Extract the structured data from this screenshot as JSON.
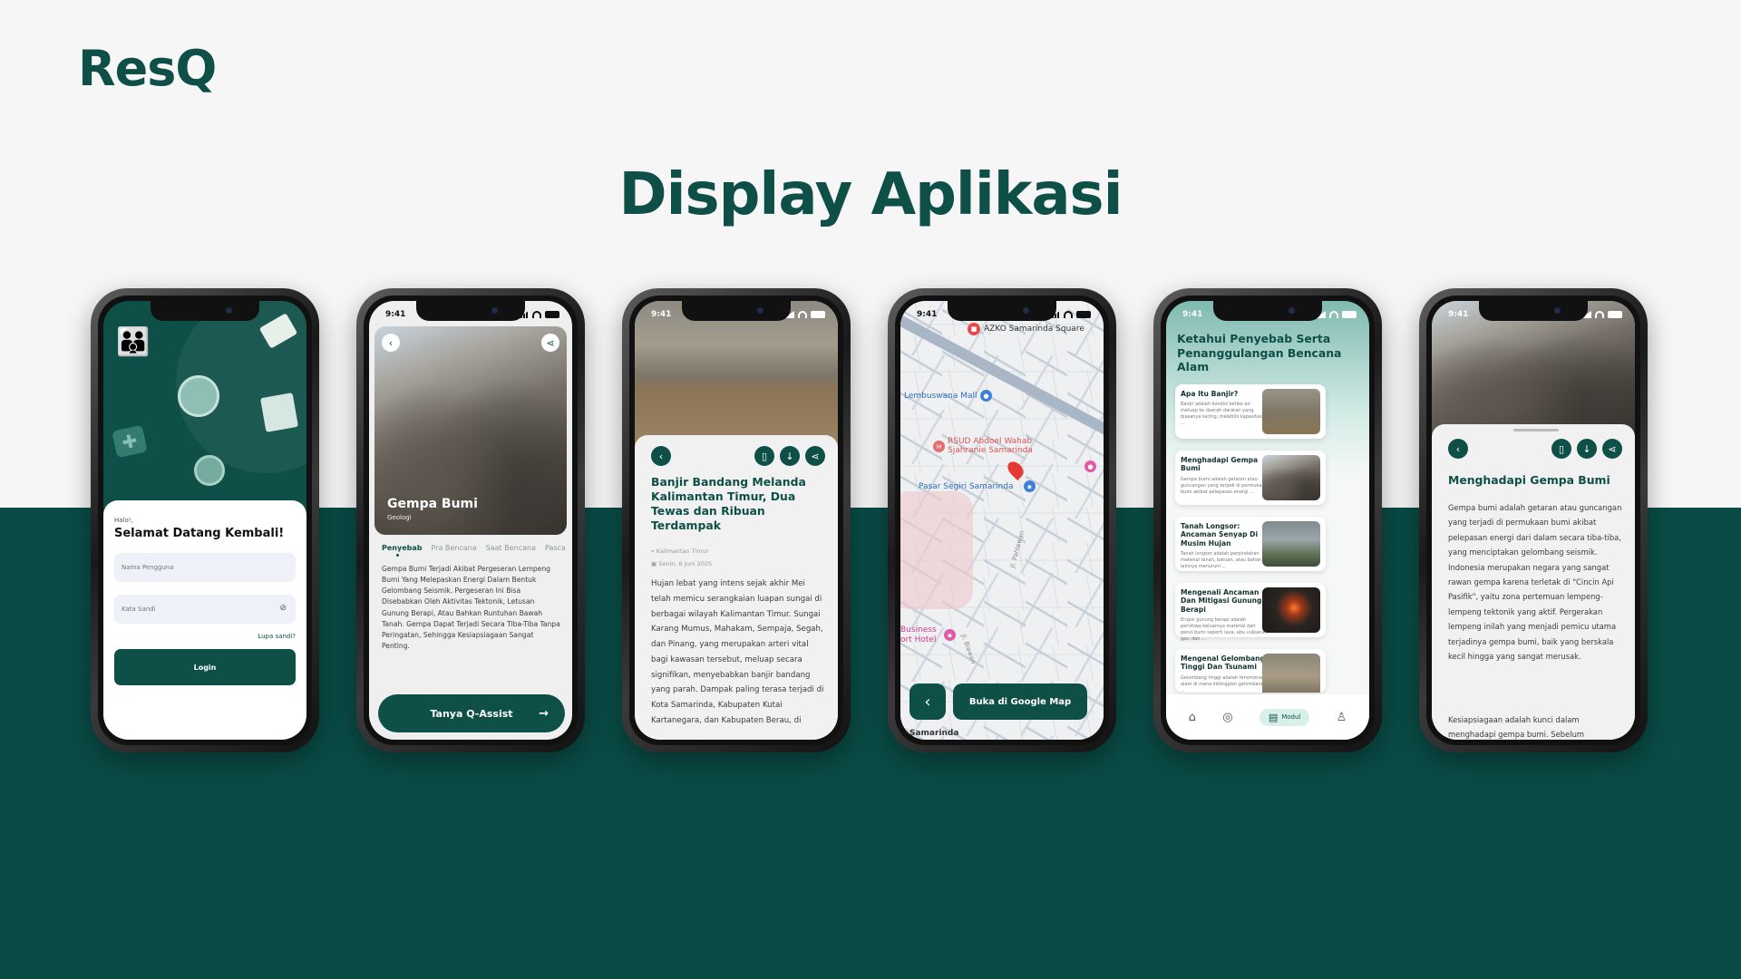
{
  "brand": {
    "logo": "ResQ"
  },
  "slide": {
    "title": "Display Aplikasi"
  },
  "status_time": "9:41",
  "login": {
    "greeting": "Halo!,",
    "welcome": "Selamat Datang Kembali!",
    "username_placeholder": "Nama Pengguna",
    "password_placeholder": "Kata Sandi",
    "forgot": "Lupa sandi?",
    "login_button": "Login"
  },
  "quake_detail": {
    "title": "Gempa Bumi",
    "category": "Geologi",
    "tabs": [
      "Penyebab",
      "Pra Bencana",
      "Saat Bencana",
      "Pasca"
    ],
    "body": "Gempa Bumi Terjadi Akibat Pergeseran Lempeng Bumi Yang Melepaskan Energi Dalam Bentuk Gelombang Seismik. Pergeseran Ini Bisa Disebabkan Oleh Aktivitas Tektonik, Letusan Gunung Berapi, Atau Bahkan Runtuhan Bawah Tanah. Gempa Dapat Terjadi Secara Tiba-Tiba Tanpa Peringatan, Sehingga Kesiapsiagaan Sangat Penting.",
    "assist_button": "Tanya Q-Assist"
  },
  "news": {
    "title": "Banjir Bandang Melanda Kalimantan Timur, Dua Tewas dan Ribuan Terdampak",
    "location": "Kalimantan Timur",
    "date": "Senin, 6 Juni 2025",
    "body": "Hujan lebat yang intens sejak akhir Mei telah memicu serangkaian luapan sungai di berbagai wilayah Kalimantan Timur. Sungai Karang Mumus, Mahakam, Sempaja, Segah, dan Pinang, yang merupakan arteri vital bagi kawasan tersebut, meluap secara signifikan, menyebabkan banjir bandang yang parah. Dampak paling terasa terjadi di Kota Samarinda, Kabupaten Kutai Kartanegara, dan Kabupaten Berau, di"
  },
  "map": {
    "labels": {
      "azko": "AZKO Samarinda Square",
      "lembuswana": "Lembuswana Mall",
      "rsud": "RSUD Abdoel Wahab Sjahranie Samarinda",
      "pasar": "Pasar Segiri Samarinda",
      "hotel": "Business ort Hotel",
      "city": "Samarinda",
      "street1": "Jl. Pahlawan",
      "street2": "Jl. Biawan"
    },
    "google_button": "Buka di Google Map"
  },
  "modul": {
    "header": "Ketahui Penyebab Serta Penanggulangan Bencana Alam",
    "cards": [
      {
        "title": "Apa Itu Banjir?",
        "desc": "Banjir adalah kondisi ketika air meluap ke daerah daratan yang biasanya kering, melebihi kapasitas ..."
      },
      {
        "title": "Menghadapi Gempa Bumi",
        "desc": "Gempa bumi adalah getaran atau guncangan yang terjadi di permukaan bumi akibat pelepasan energi ..."
      },
      {
        "title": "Tanah Longsor: Ancaman Senyap Di Musim Hujan",
        "desc": "Tanah longsor adalah perpindahan material tanah, batuan, atau bahan lainnya menuruni ..."
      },
      {
        "title": "Mengenali Ancaman Dan Mitigasi Gunung Berapi",
        "desc": "Erupsi gunung berapi adalah peristiwa keluarnya material dari perut bumi seperti lava, abu vulkanik, gas, dan ..."
      },
      {
        "title": "Mengenal Gelombang Tinggi Dan Tsunami",
        "desc": "Gelombang tinggi adalah fenomena alam di mana ketinggian gelombang ..."
      }
    ],
    "nav_active": "Modul"
  },
  "quake_article": {
    "title": "Menghadapi Gempa Bumi",
    "para1": "Gempa bumi adalah getaran atau guncangan yang terjadi di permukaan bumi akibat pelepasan energi dari dalam secara tiba-tiba, yang menciptakan gelombang seismik. Indonesia merupakan negara yang sangat rawan gempa karena terletak di \"Cincin Api Pasifik\", yaitu zona pertemuan lempeng-lempeng tektonik yang aktif. Pergerakan lempeng inilah yang menjadi pemicu utama terjadinya gempa bumi, baik yang berskala kecil hingga yang sangat merusak.",
    "para2": "Kesiapsiagaan adalah kunci dalam menghadapi gempa bumi. Sebelum"
  },
  "colors": {
    "primary": "#0e4f48",
    "background": "#f6f6f6",
    "accent_light": "#d9f0ea"
  }
}
